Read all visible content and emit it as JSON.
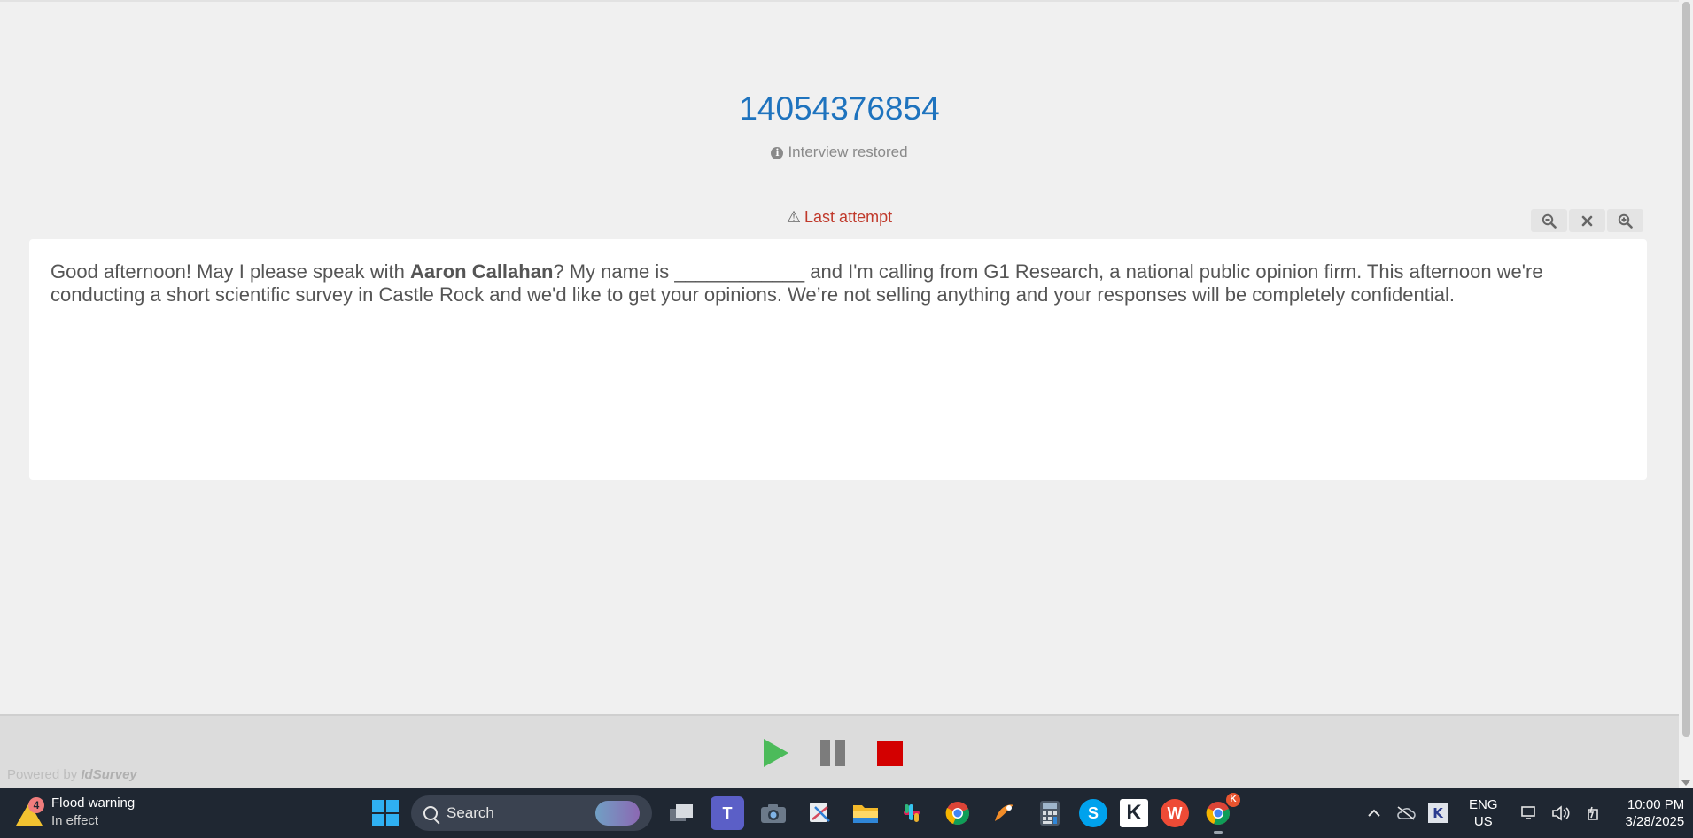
{
  "survey": {
    "id": "14054376854",
    "status": "Interview restored",
    "warning": "Last attempt"
  },
  "question": {
    "part1": "Good afternoon!  May I please speak with ",
    "respondent_name": "Aaron Callahan",
    "part2": "? My name is ____________ and I'm calling from G1 Research, a national public opinion firm. This afternoon we're conducting a short scientific survey in Castle Rock and we'd like to get your opinions. We’re not selling anything and your responses will be completely confidential."
  },
  "footer": {
    "powered_by": "Powered by",
    "brand": "IdSurvey"
  },
  "taskbar": {
    "weather_badge": "4",
    "weather_title": "Flood warning",
    "weather_sub": "In effect",
    "search_label": "Search",
    "lang_top": "ENG",
    "lang_bottom": "US",
    "time": "10:00 PM",
    "date": "3/28/2025",
    "chrome_badge": "K"
  },
  "colors": {
    "accent": "#1e73be",
    "warning": "#c0392b",
    "play": "#4cbb5a",
    "stop": "#d30000"
  }
}
